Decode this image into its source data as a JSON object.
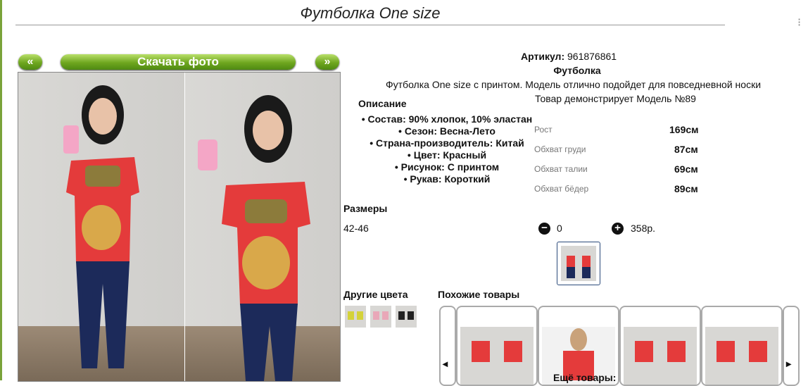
{
  "page": {
    "title": "Футболка One size"
  },
  "gallery": {
    "prev_label": "«",
    "download_label": "Скачать фото",
    "next_label": "»"
  },
  "product": {
    "sku_label": "Артикул:",
    "sku_value": "961876861",
    "name": "Футболка",
    "description": "Футболка One size с принтом. Модель отлично подойдет для повседневной носки",
    "model_note": "Товар демонстрирует Модель №89",
    "details_heading": "Описание",
    "properties": [
      "• Состав: 90% хлопок, 10% эластан",
      "• Сезон: Весна-Лето",
      "• Страна-производитель: Китай",
      "• Цвет: Красный",
      "• Рисунок: С принтом",
      "• Рукав: Короткий"
    ]
  },
  "measurements": [
    {
      "label": "Рост",
      "value": "169см"
    },
    {
      "label": "Обхват груди",
      "value": "87см"
    },
    {
      "label": "Обхват талии",
      "value": "69см"
    },
    {
      "label": "Обхват бёдер",
      "value": "89см"
    }
  ],
  "sizes": {
    "heading": "Размеры",
    "size": "42-46",
    "minus": "−",
    "plus": "+",
    "quantity": "0",
    "price": "358р."
  },
  "other_colors": {
    "heading": "Другие цвета"
  },
  "similar": {
    "heading": "Похожие товары",
    "prev": "◂",
    "next": "▸",
    "more_label": "Ещё товары:"
  },
  "colors": {
    "accent": "#6ea61f",
    "shirt": "#e43b3b",
    "jeans": "#1c2a5a",
    "border": "#2b4a7a"
  }
}
